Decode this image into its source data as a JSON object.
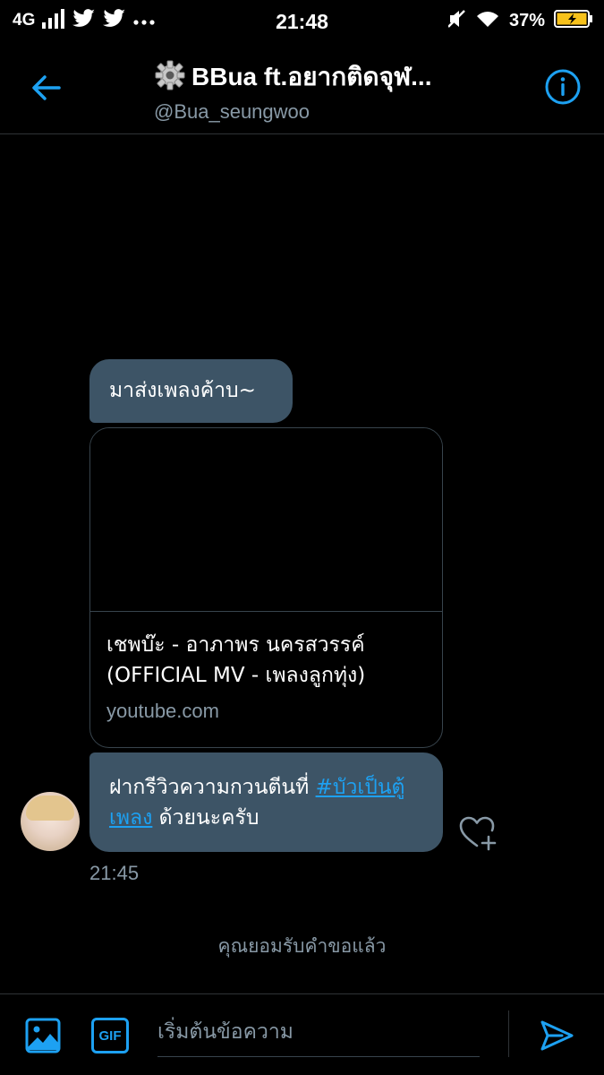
{
  "status_bar": {
    "network": "4G",
    "time": "21:48",
    "battery": "37%",
    "icons": [
      "signal-icon",
      "twitter-icon",
      "twitter-icon",
      "more-dots-icon",
      "mute-icon",
      "wifi-icon",
      "battery-icon"
    ]
  },
  "header": {
    "title": "BBua ft.อยากติดจุฬ...",
    "handle": "@Bua_seungwoo",
    "back_icon": "back-arrow-icon",
    "info_icon": "info-icon",
    "title_emoji": "gear-icon"
  },
  "messages": {
    "msg1": "มาส่งเพลงค้าบ~",
    "card": {
      "title": "เชพบ๊ะ - อาภาพร นครสวรรค์ (OFFICIAL MV - เพลงลูกทุ่ง)",
      "domain": "youtube.com"
    },
    "msg3": {
      "text_before": "ฝากรีวิวความกวนตีนที่ ",
      "hashtag": "#บัวเป็นตู้เพลง",
      "text_after": " ด้วยนะครับ"
    },
    "timestamp": "21:45"
  },
  "accepted_notice": "คุณยอมรับคำขอแล้ว",
  "composer": {
    "placeholder": "เริ่มต้นข้อความ",
    "gif_label": "GIF"
  },
  "colors": {
    "accent": "#1da1f2",
    "bubble": "#3d5466",
    "muted": "#8899a6",
    "background": "#000000"
  }
}
